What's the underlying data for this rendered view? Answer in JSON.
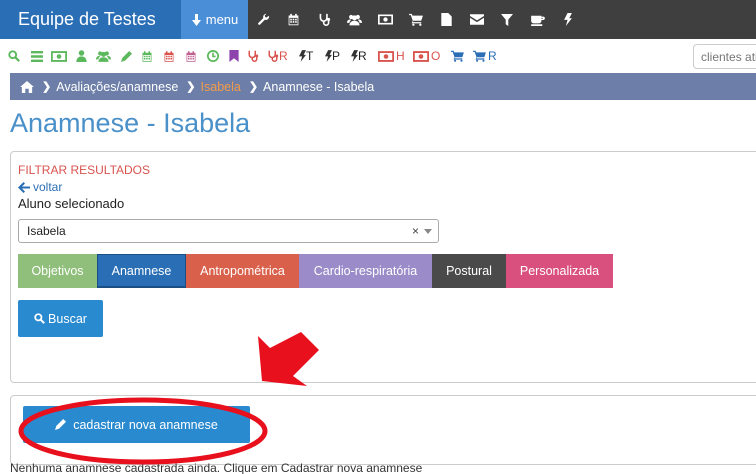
{
  "app": {
    "title": "Equipe de Testes",
    "menu_label": "menu"
  },
  "topnav_icons": [
    "wrench-icon",
    "calendar-icon",
    "stethoscope-icon",
    "users-icon",
    "money-icon",
    "cart-icon",
    "file-icon",
    "envelope-icon",
    "filter-icon",
    "coffee-icon",
    "bolt-icon"
  ],
  "toolbar": {
    "items": [
      {
        "icon": "search-icon",
        "color": "#5cb85c"
      },
      {
        "icon": "list-icon",
        "color": "#5cb85c"
      },
      {
        "icon": "money-icon",
        "color": "#5cb85c"
      },
      {
        "icon": "user-icon",
        "color": "#5cb85c"
      },
      {
        "icon": "users-icon",
        "color": "#5cb85c"
      },
      {
        "icon": "pencil-icon",
        "color": "#5cb85c"
      },
      {
        "icon": "calendar-icon",
        "color": "#5cb85c"
      },
      {
        "icon": "calendar-icon",
        "color": "#d9534f"
      },
      {
        "icon": "calendar-icon",
        "color": "#c06090"
      },
      {
        "icon": "clock-icon",
        "color": "#5cb85c"
      },
      {
        "icon": "bookmark-icon",
        "color": "#8e44ad"
      },
      {
        "icon": "stethoscope-icon",
        "color": "#d9534f"
      },
      {
        "icon": "stethoscope-icon",
        "color": "#d9534f",
        "suffix": "R"
      },
      {
        "icon": "bolt-icon",
        "color": "#333",
        "suffix": "T"
      },
      {
        "icon": "bolt-icon",
        "color": "#333",
        "suffix": "P"
      },
      {
        "icon": "bolt-icon",
        "color": "#333",
        "suffix": "R"
      },
      {
        "icon": "money-icon",
        "color": "#d9534f",
        "suffix": "H"
      },
      {
        "icon": "money-icon",
        "color": "#d9534f",
        "suffix": "O"
      },
      {
        "icon": "cart-icon",
        "color": "#2a6fb6"
      },
      {
        "icon": "cart-icon",
        "color": "#2a6fb6",
        "suffix": "R"
      }
    ],
    "search_placeholder": "clientes ativos"
  },
  "breadcrumb": {
    "home_icon": "home-icon",
    "items": [
      "Avaliações/anamnese",
      "Isabela",
      "Anamnese - Isabela"
    ]
  },
  "page_title": "Anamnese - Isabela",
  "filter": {
    "title": "FILTRAR RESULTADOS",
    "back_label": "voltar",
    "student_label": "Aluno selecionado",
    "student_value": "Isabela",
    "clear_symbol": "×"
  },
  "tabs": [
    {
      "label": "Objetivos",
      "color": "#8fbf7a",
      "active": false
    },
    {
      "label": "Anamnese",
      "color": "#2a6fb6",
      "active": true
    },
    {
      "label": "Antropométrica",
      "color": "#d9604b",
      "active": false
    },
    {
      "label": "Cardio-respiratória",
      "color": "#9b8bc8",
      "active": false
    },
    {
      "label": "Postural",
      "color": "#4a4a4a",
      "active": false
    },
    {
      "label": "Personalizada",
      "color": "#d9507e",
      "active": false
    }
  ],
  "buttons": {
    "search": "Buscar",
    "create": "cadastrar nova anamnese"
  },
  "empty_message": "Nenhuma anamnese cadastrada ainda. Clique em Cadastrar nova anamnese",
  "annotation_color": "#e8101c"
}
